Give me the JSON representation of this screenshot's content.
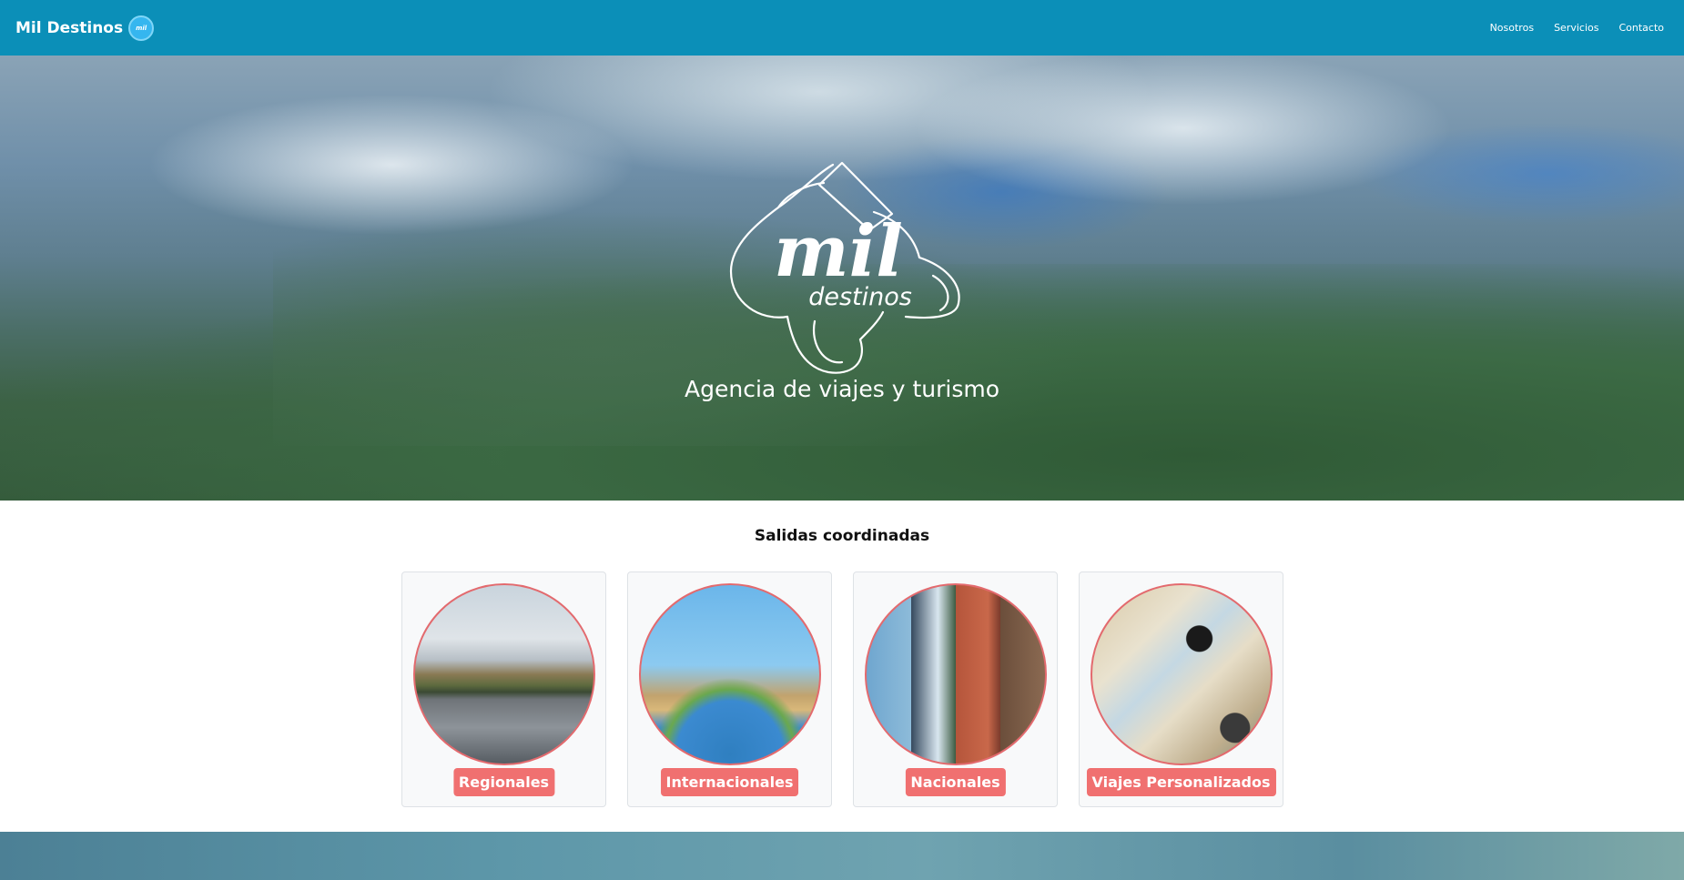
{
  "navbar": {
    "brand": "Mil Destinos",
    "brand_badge": "mil",
    "links": [
      "Nosotros",
      "Servicios",
      "Contacto"
    ],
    "background_color": "#0b8fb8"
  },
  "hero": {
    "logo_text_main": "mil",
    "logo_text_sub": "destinos",
    "subtitle": "Agencia de viajes y turismo"
  },
  "section": {
    "title": "Salidas coordinadas",
    "cards": [
      {
        "label": "Regionales"
      },
      {
        "label": "Internacionales"
      },
      {
        "label": "Nacionales"
      },
      {
        "label": "Viajes Personalizados"
      }
    ],
    "accent_color": "#f07070"
  }
}
